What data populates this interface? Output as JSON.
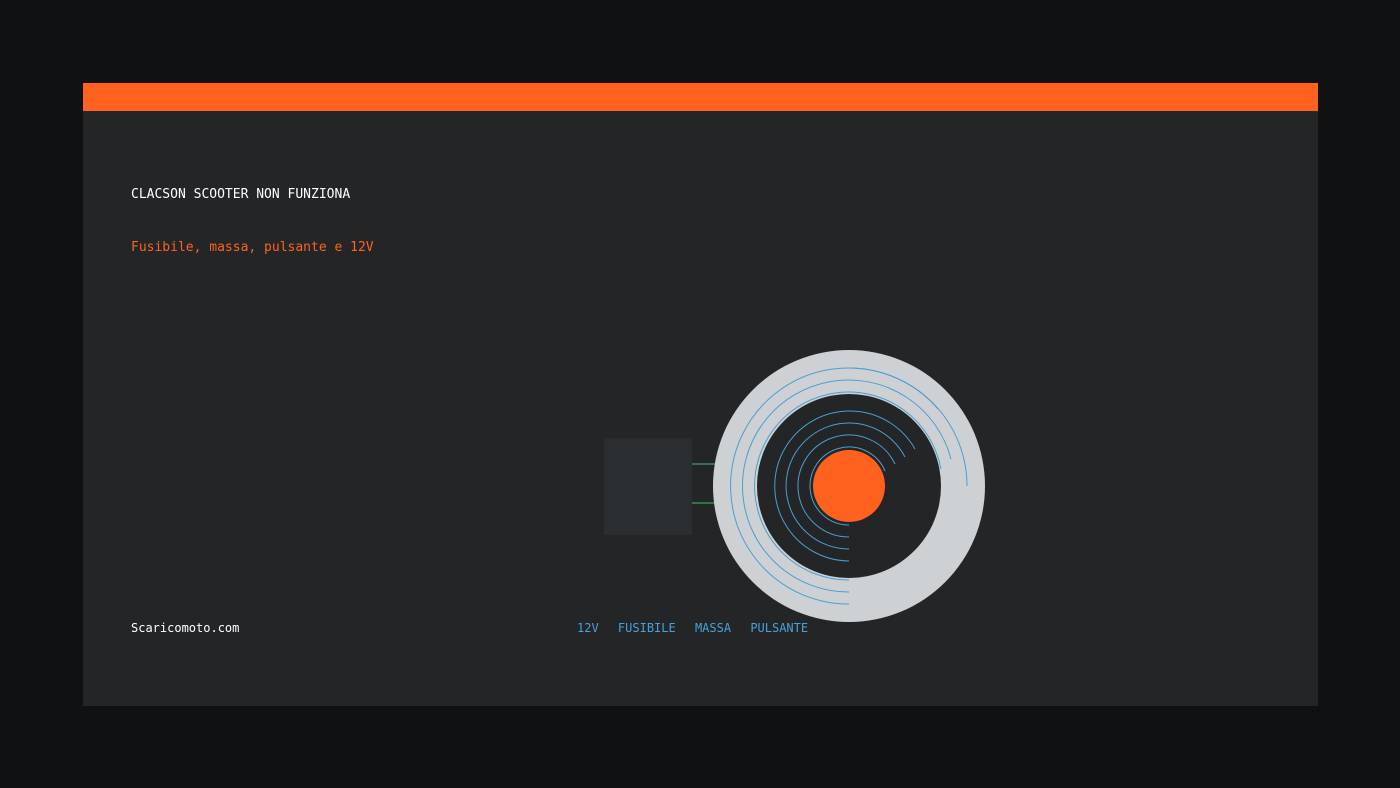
{
  "header": {
    "title": "CLACSON SCOOTER NON FUNZIONA",
    "subtitle": "Fusibile, massa, pulsante e 12V"
  },
  "footer": {
    "brand": "Scaricomoto.com",
    "tags": [
      "12V",
      "FUSIBILE",
      "MASSA",
      "PULSANTE"
    ]
  },
  "colors": {
    "accent": "#ff621f",
    "background": "#0f1113",
    "card": "#232527",
    "tag": "#48a0d8",
    "wave": "#4aa0d0",
    "wire": "#3fbf6f",
    "horn_ring": "#cdd1d4"
  },
  "illustration": {
    "icon": "horn-icon"
  }
}
